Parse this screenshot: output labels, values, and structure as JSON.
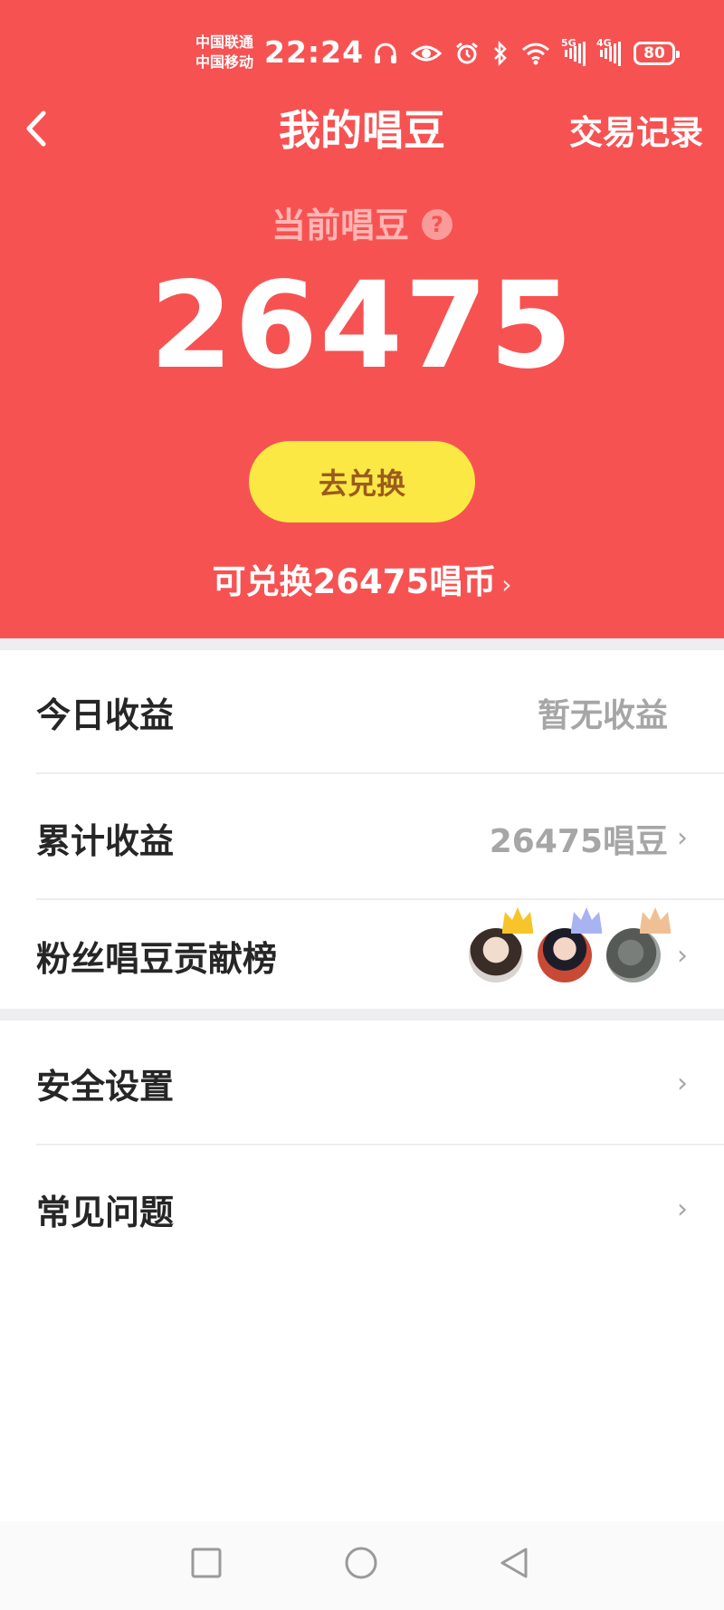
{
  "status_bar": {
    "carrier_1": "中国联通",
    "carrier_2": "中国移动",
    "time": "22:24",
    "signal_1": "5G",
    "signal_2": "4G",
    "battery": "80"
  },
  "nav": {
    "title": "我的唱豆",
    "records_link": "交易记录"
  },
  "balance": {
    "label": "当前唱豆",
    "help": "?",
    "amount": "26475",
    "exchange_button": "去兑换",
    "convertible_text": "可兑换26475唱币",
    "convertible_arrow": "›"
  },
  "rows_group1": {
    "today": {
      "label": "今日收益",
      "value": "暂无收益"
    },
    "total": {
      "label": "累计收益",
      "value": "26475唱豆",
      "arrow": "›"
    },
    "ranking": {
      "label": "粉丝唱豆贡献榜",
      "arrow": "›"
    }
  },
  "rows_group2": {
    "security": {
      "label": "安全设置",
      "arrow": "›"
    },
    "faq": {
      "label": "常见问题",
      "arrow": "›"
    }
  },
  "colors": {
    "header_bg": "#f75252",
    "button_bg": "#fbe845",
    "crown_gold": "#f7c52a",
    "crown_silver": "#a9b3f2",
    "crown_bronze": "#f0c095"
  }
}
